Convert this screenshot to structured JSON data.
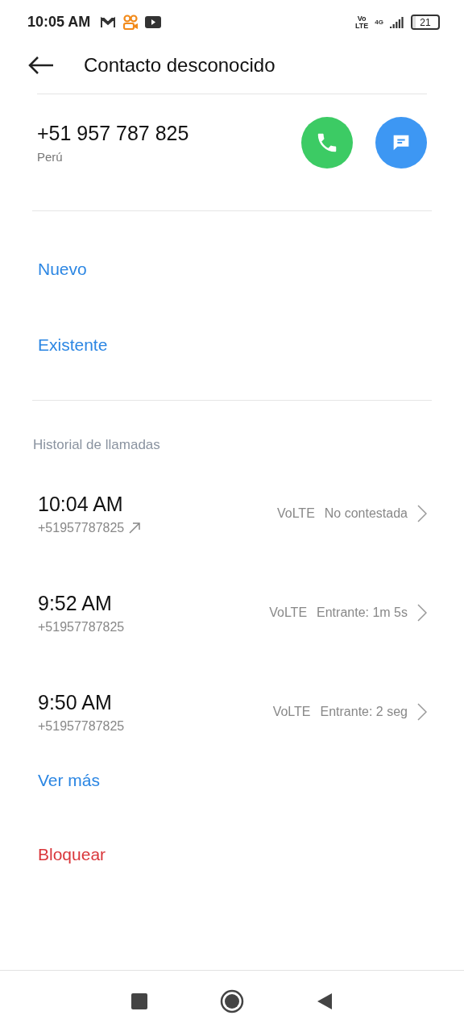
{
  "status_bar": {
    "time": "10:05 AM",
    "volte": [
      "Vo",
      "LTE"
    ],
    "network": "4G",
    "battery": "21"
  },
  "header": {
    "title": "Contacto desconocido"
  },
  "contact": {
    "number": "+51 957 787 825",
    "country": "Perú"
  },
  "add_options": [
    "Nuevo",
    "Existente"
  ],
  "history": {
    "title": "Historial de llamadas",
    "calls": [
      {
        "time": "10:04 AM",
        "number": "+51957787825",
        "outgoing": true,
        "network": "VoLTE",
        "status": "No contestada"
      },
      {
        "time": "9:52 AM",
        "number": "+51957787825",
        "outgoing": false,
        "network": "VoLTE",
        "status": "Entrante: 1m 5s"
      },
      {
        "time": "9:50 AM",
        "number": "+51957787825",
        "outgoing": false,
        "network": "VoLTE",
        "status": "Entrante: 2 seg"
      }
    ]
  },
  "actions": [
    {
      "label": "Ver más",
      "kind": "link"
    },
    {
      "label": "Bloquear",
      "kind": "danger"
    }
  ]
}
